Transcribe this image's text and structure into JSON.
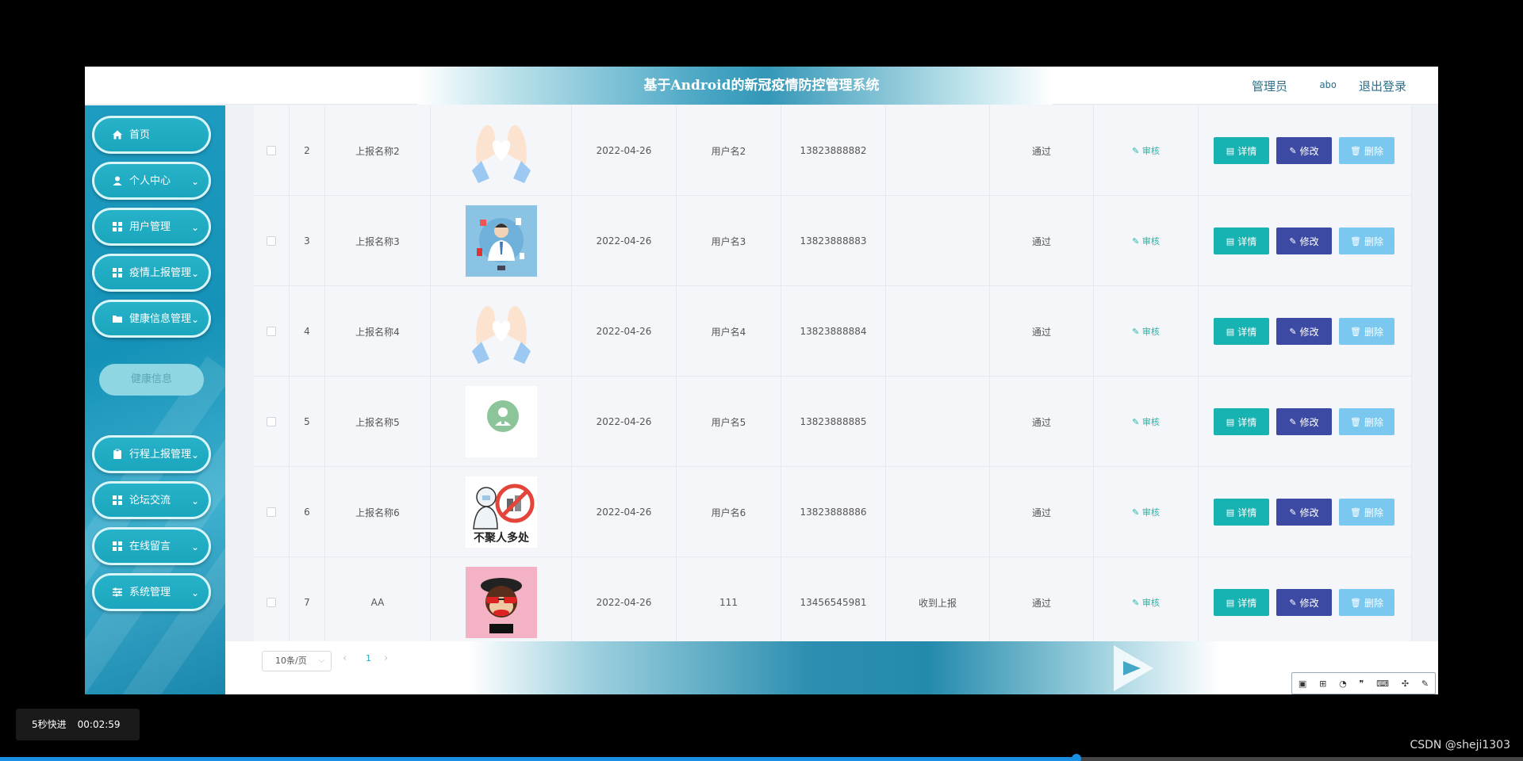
{
  "app": {
    "title": "基于Android的新冠疫情防控管理系统",
    "user_role": "管理员",
    "user_name": "abo",
    "logout_label": "退出登录"
  },
  "sidebar": {
    "items": [
      {
        "label": "首页",
        "icon": "home-icon"
      },
      {
        "label": "个人中心",
        "icon": "user-icon"
      },
      {
        "label": "用户管理",
        "icon": "grid-icon"
      },
      {
        "label": "疫情上报管理",
        "icon": "grid-icon"
      },
      {
        "label": "健康信息管理",
        "icon": "folder-icon"
      },
      {
        "label": "行程上报管理",
        "icon": "clipboard-icon"
      },
      {
        "label": "论坛交流",
        "icon": "grid-icon"
      },
      {
        "label": "在线留言",
        "icon": "grid-icon"
      },
      {
        "label": "系统管理",
        "icon": "sliders-icon"
      }
    ],
    "submenu": {
      "label": "健康信息"
    }
  },
  "table": {
    "rows": [
      {
        "index": "2",
        "name": "上报名称2",
        "image": "heart-hands-image",
        "date": "2022-04-26",
        "user": "用户名2",
        "phone": "13823888882",
        "remark": "",
        "status": "通过",
        "audit": "审核"
      },
      {
        "index": "3",
        "name": "上报名称3",
        "image": "doctor-image",
        "date": "2022-04-26",
        "user": "用户名3",
        "phone": "13823888883",
        "remark": "",
        "status": "通过",
        "audit": "审核"
      },
      {
        "index": "4",
        "name": "上报名称4",
        "image": "heart-hands-image",
        "date": "2022-04-26",
        "user": "用户名4",
        "phone": "13823888884",
        "remark": "",
        "status": "通过",
        "audit": "审核"
      },
      {
        "index": "5",
        "name": "上报名称5",
        "image": "medic-badge-image",
        "date": "2022-04-26",
        "user": "用户名5",
        "phone": "13823888885",
        "remark": "",
        "status": "通过",
        "audit": "审核"
      },
      {
        "index": "6",
        "name": "上报名称6",
        "image": "no-gathering-image",
        "image_text": "不聚人多处",
        "date": "2022-04-26",
        "user": "用户名6",
        "phone": "13823888886",
        "remark": "",
        "status": "通过",
        "audit": "审核"
      },
      {
        "index": "7",
        "name": "AA",
        "image": "cartoon-avatar-image",
        "date": "2022-04-26",
        "user": "111",
        "phone": "13456545981",
        "remark": "收到上报",
        "status": "通过",
        "audit": "审核"
      }
    ],
    "actions": {
      "detail": "详情",
      "edit": "修改",
      "delete": "删除"
    }
  },
  "pagination": {
    "page_size": "10条/页",
    "current_page": "1",
    "prev": "‹",
    "next": "›"
  },
  "video": {
    "fast_forward": "5秒快进",
    "time": "00:02:59",
    "progress": 0.707,
    "credit": "CSDN @sheji1303"
  },
  "colors": {
    "accent": "#1aa6bd",
    "detail_button": "#17b3b3",
    "edit_button": "#3d4aa3",
    "delete_button": "#7ac8f0",
    "progress": "#1a8fe3"
  }
}
